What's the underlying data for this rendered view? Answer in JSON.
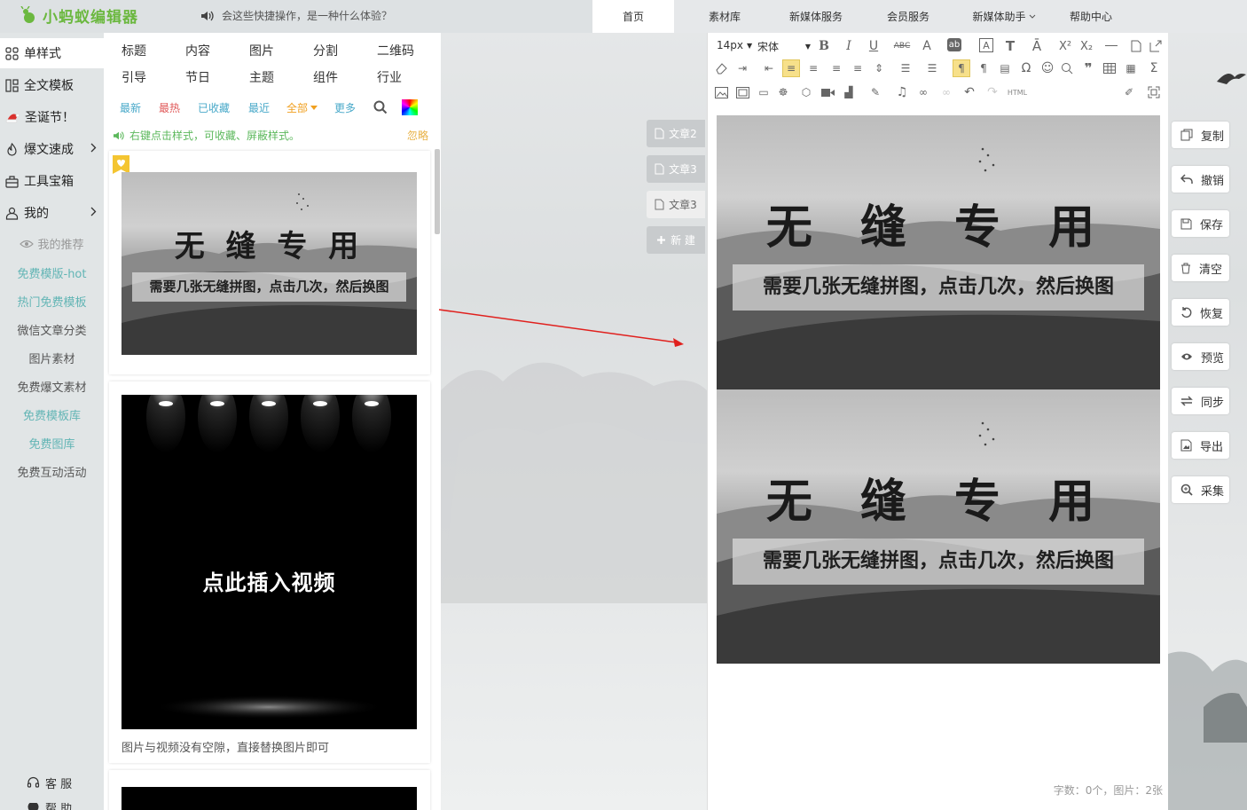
{
  "header": {
    "logo": "小蚂蚁编辑器",
    "notice": "会这些快捷操作，是一种什么体验？",
    "nav": [
      "首页",
      "素材库",
      "新媒体服务",
      "会员服务",
      "新媒体助手",
      "帮助中心"
    ],
    "active_nav": "首页"
  },
  "sidebar": {
    "items": [
      {
        "label": "单样式",
        "icon": "grid-icon"
      },
      {
        "label": "全文模板",
        "icon": "layout-icon"
      },
      {
        "label": "圣诞节！",
        "icon": "santa-hat-icon"
      },
      {
        "label": "爆文速成",
        "icon": "flame-icon"
      },
      {
        "label": "工具宝箱",
        "icon": "toolbox-icon"
      },
      {
        "label": "我的",
        "icon": "user-icon"
      }
    ],
    "links": [
      "我的推荐",
      "免费模版-hot",
      "热门免费模板",
      "微信文章分类",
      "图片素材",
      "免费爆文素材",
      "免费模板库",
      "免费图库",
      "免费互动活动"
    ],
    "support": "客 服",
    "help": "帮 助"
  },
  "panel": {
    "categories": [
      "标题",
      "内容",
      "图片",
      "分割",
      "二维码",
      "引导",
      "节日",
      "主题",
      "组件",
      "行业"
    ],
    "filters": [
      "最新",
      "最热",
      "已收藏",
      "最近",
      "全部",
      "更多"
    ],
    "tip": "右键点击样式，可收藏、屏蔽样式。",
    "ignore": "忽略",
    "card1": {
      "title": "无 缝 专 用",
      "caption": "需要几张无缝拼图，点击几次，然后换图"
    },
    "card2": {
      "video_text": "点此插入视频",
      "caption": "图片与视频没有空隙，直接替换图片即可"
    }
  },
  "doc_tabs": {
    "items": [
      "文章2",
      "文章3",
      "文章3"
    ],
    "new_label": "新 建"
  },
  "editor": {
    "font_size": "14px",
    "font_family": "宋体",
    "html_label": "HTML",
    "image_title": "无 缝 专 用",
    "image_caption": "需要几张无缝拼图，点击几次，然后换图",
    "count": "字数：0个，图片：2张"
  },
  "actions": [
    "复制",
    "撤销",
    "保存",
    "清空",
    "恢复",
    "预览",
    "同步",
    "导出",
    "采集"
  ],
  "colors": {
    "logo_green": "#6bb83f",
    "teal": "#62b5b5",
    "filter_blue": "#49a9c9",
    "hot_red": "#e05a5a",
    "orange": "#f0a020",
    "arrow_red": "#e0201d",
    "highlight": "#f7e08a"
  }
}
